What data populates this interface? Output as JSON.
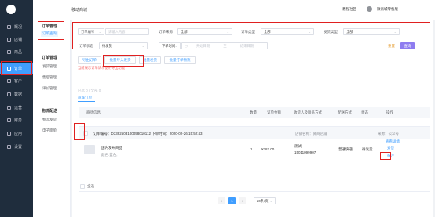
{
  "sidebar": {
    "items": [
      {
        "label": "概况",
        "icon": "overview-icon"
      },
      {
        "label": "店铺",
        "icon": "shop-icon"
      },
      {
        "label": "商品",
        "icon": "goods-icon"
      },
      {
        "label": "订单",
        "icon": "order-icon",
        "active": true
      },
      {
        "label": "客户",
        "icon": "customer-icon"
      },
      {
        "label": "数据",
        "icon": "data-icon"
      },
      {
        "label": "运营",
        "icon": "operate-icon"
      },
      {
        "label": "财务",
        "icon": "finance-icon"
      },
      {
        "label": "应用",
        "icon": "app-icon"
      },
      {
        "label": "设置",
        "icon": "settings-icon"
      }
    ]
  },
  "topbar": {
    "title": "移动商城",
    "help": "教程社区",
    "store": "微商城零售版"
  },
  "subnav": {
    "group1": "订单管理",
    "group1_items": [
      "订单查询",
      "发货管理",
      "售后管理",
      "评价管理"
    ],
    "group1_active": "订单管理",
    "group2": "物流配送",
    "group2_items": [
      "物流发货",
      "电子面单"
    ]
  },
  "filters": {
    "order_no_label": "订单编号",
    "order_no_placeholder": "请输入内容",
    "order_source_label": "订单来源",
    "order_source_value": "全部",
    "order_type_label": "订单类型",
    "order_type_value": "全部",
    "ship_type_label": "发货类型",
    "ship_type_value": "全部",
    "status_label": "订单状态",
    "status_value": "待发货",
    "time_type_value": "下单时间",
    "start_placeholder": "开始日期",
    "range_sep": "至",
    "end_placeholder": "结束日期",
    "reset": "重置",
    "search": "查询"
  },
  "actions": {
    "export": "导出订单",
    "batch_import": "批量导入发货",
    "batch_ship": "批量发货",
    "batch_print": "批量打单物流",
    "notice": "当前展示订单请勿使用导出功能"
  },
  "tabs": {
    "summary": "已选 0 / 全部 0",
    "current": "商城订单"
  },
  "table": {
    "headers": [
      "商品信息",
      "数量",
      "订单金额",
      "收货人及联系方式",
      "配送方式",
      "状态",
      "操作"
    ],
    "order": {
      "meta": "订单编号：D3392503100058010112 下单时间：2020-02-26 15:52:43",
      "store_label": "店铺名称：微商店铺",
      "source_label": "来源：公众号",
      "product_name": "国内发布商品",
      "product_spec": "颜色:蓝色;",
      "qty": "1",
      "amount": "¥382.00",
      "receiver_name": "测试",
      "receiver_phone": "15011099907",
      "delivery": "普通快递",
      "status": "待发货",
      "op_detail": "查看详情",
      "op_ship": "发货",
      "op_remark": "备注"
    }
  },
  "footer": {
    "select_all": "全选",
    "prev": "‹",
    "page": "1",
    "next": "›",
    "page_size": "20条/页"
  },
  "colors": {
    "accent": "#409eff",
    "highlight": "#e02020",
    "nav_bg": "#1f2d3d",
    "primary_btn": "#8e7cf0"
  }
}
